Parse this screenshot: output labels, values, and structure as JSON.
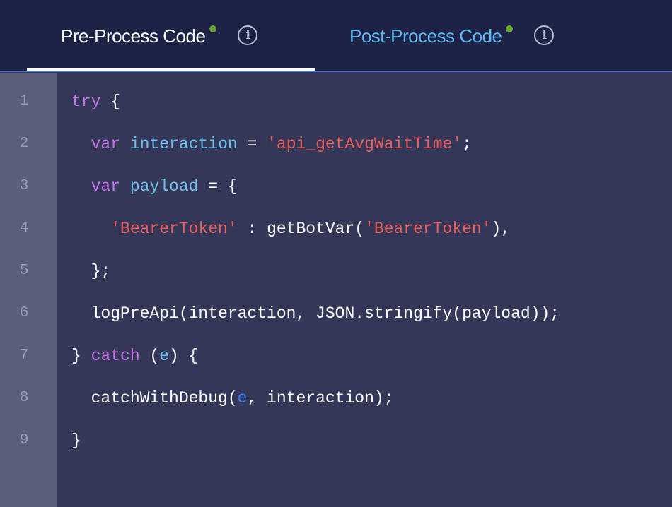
{
  "tabs": [
    {
      "label": "Pre-Process Code",
      "active": true,
      "status": "saved",
      "info_icon": "info-icon"
    },
    {
      "label": "Post-Process Code",
      "active": false,
      "status": "saved",
      "info_icon": "info-icon"
    }
  ],
  "info_glyph": "i",
  "colors": {
    "header_bg": "#1d2247",
    "active_tab_text": "#ffffff",
    "inactive_tab_text": "#5cb8ee",
    "status_dot": "#6aa535",
    "editor_bg": "#343757",
    "gutter_bg": "#5b5e7a",
    "keyword": "#c774e8",
    "variable": "#6cc0ee",
    "string": "#e85e5e"
  },
  "editor": {
    "lines": [
      {
        "n": "1",
        "tokens": [
          [
            "kw",
            "try"
          ],
          [
            "plain",
            " {"
          ]
        ]
      },
      {
        "n": "2",
        "tokens": [
          [
            "plain",
            "  "
          ],
          [
            "kw",
            "var"
          ],
          [
            "plain",
            " "
          ],
          [
            "var",
            "interaction"
          ],
          [
            "plain",
            " = "
          ],
          [
            "str",
            "'api_getAvgWaitTime'"
          ],
          [
            "plain",
            ";"
          ]
        ]
      },
      {
        "n": "3",
        "tokens": [
          [
            "plain",
            "  "
          ],
          [
            "kw",
            "var"
          ],
          [
            "plain",
            " "
          ],
          [
            "var",
            "payload"
          ],
          [
            "plain",
            " = {"
          ]
        ]
      },
      {
        "n": "4",
        "tokens": [
          [
            "plain",
            "    "
          ],
          [
            "str",
            "'BearerToken'"
          ],
          [
            "plain",
            " : getBotVar("
          ],
          [
            "str",
            "'BearerToken'"
          ],
          [
            "plain",
            "),"
          ]
        ]
      },
      {
        "n": "5",
        "tokens": [
          [
            "plain",
            "  };"
          ]
        ]
      },
      {
        "n": "6",
        "tokens": [
          [
            "plain",
            "  logPreApi(interaction, JSON.stringify(payload));"
          ]
        ]
      },
      {
        "n": "7",
        "tokens": [
          [
            "plain",
            "} "
          ],
          [
            "kw",
            "catch"
          ],
          [
            "plain",
            " ("
          ],
          [
            "var",
            "e"
          ],
          [
            "plain",
            ") {"
          ]
        ]
      },
      {
        "n": "8",
        "tokens": [
          [
            "plain",
            "  catchWithDebug("
          ],
          [
            "param",
            "e"
          ],
          [
            "plain",
            ", interaction);"
          ]
        ]
      },
      {
        "n": "9",
        "tokens": [
          [
            "plain",
            "}"
          ]
        ]
      }
    ]
  }
}
